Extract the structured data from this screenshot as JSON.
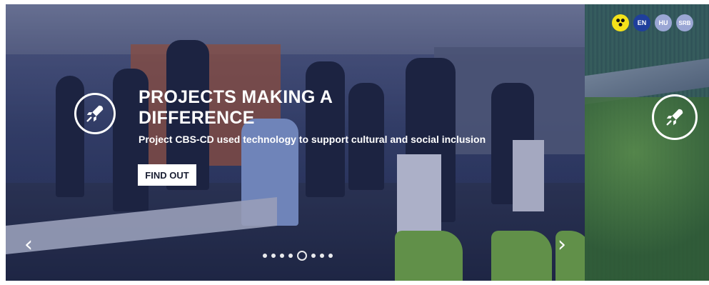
{
  "hero": {
    "headline": "PROJECTS MAKING A DIFFERENCE",
    "subline": "Project CBS-CD used technology to support cultural and social inclusion",
    "cta_label": "FIND OUT",
    "prev_arrow": "‹",
    "next_arrow": "›",
    "icon": "rocket-icon",
    "pagination": {
      "count": 8,
      "active_index": 4
    }
  },
  "next_slide": {
    "icon": "rocket-icon"
  },
  "languages": [
    {
      "code": "EN",
      "active": true
    },
    {
      "code": "HU",
      "active": false
    },
    {
      "code": "SRB",
      "active": false
    }
  ],
  "accessibility": {
    "icon": "accessibility-icon",
    "color": "#f4e21a"
  },
  "colors": {
    "accent": "#1f3f9c",
    "inactive_lang": "#9aa6d4",
    "text": "#ffffff"
  }
}
